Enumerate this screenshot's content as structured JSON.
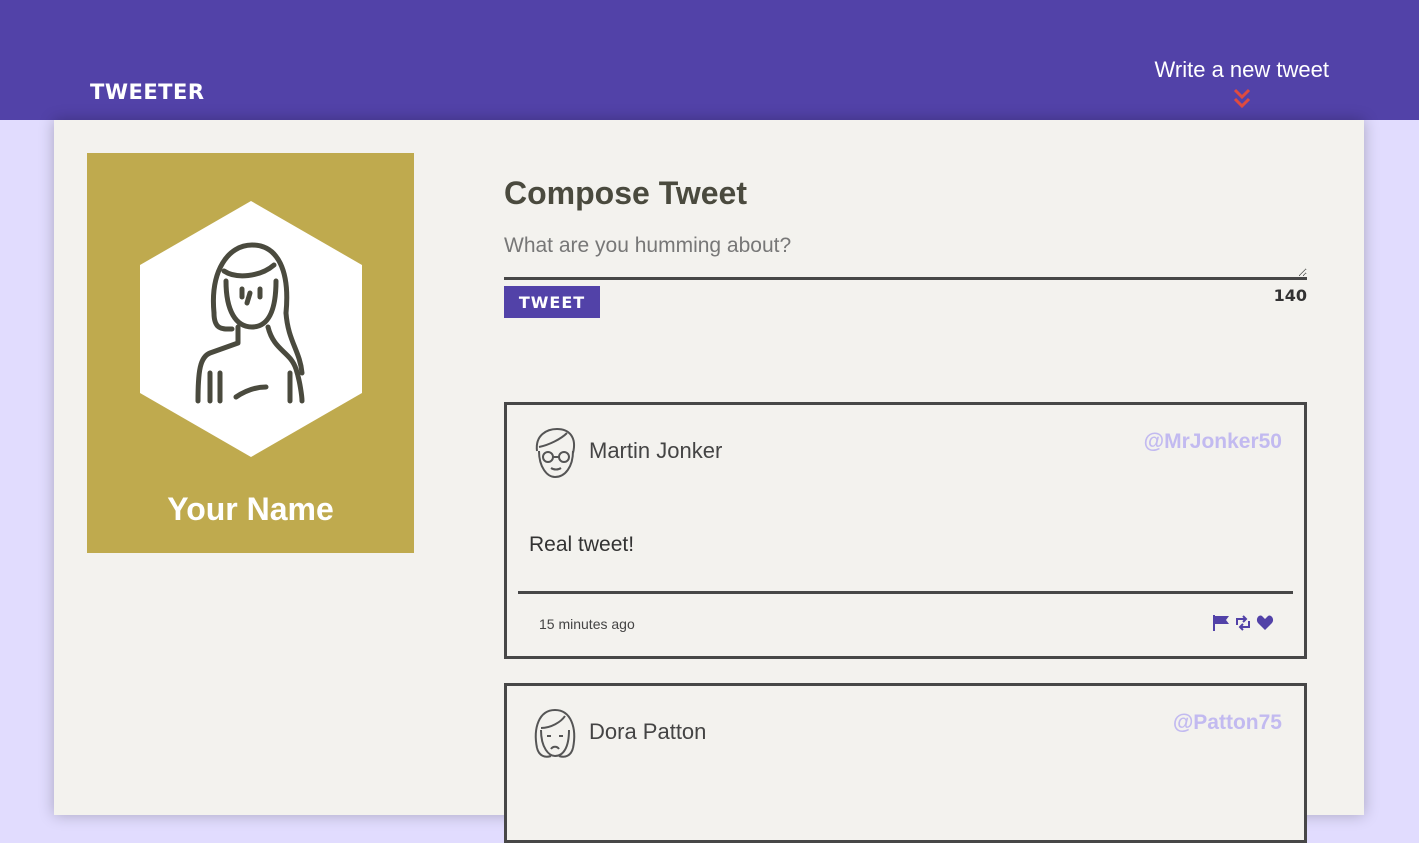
{
  "header": {
    "brand": "TWEETER",
    "new_tweet_label": "Write a new tweet"
  },
  "profile": {
    "name": "Your Name",
    "avatar_icon": "woman-avatar-icon"
  },
  "compose": {
    "title": "Compose Tweet",
    "placeholder": "What are you humming about?",
    "button_label": "TWEET",
    "counter": "140"
  },
  "tweets": [
    {
      "name": "Martin Jonker",
      "handle": "@MrJonker50",
      "content": "Real tweet!",
      "time": "15 minutes ago",
      "avatar_icon": "man-glasses-avatar-icon"
    },
    {
      "name": "Dora Patton",
      "handle": "@Patton75",
      "avatar_icon": "woman-avatar-icon"
    }
  ],
  "colors": {
    "header": "#5242a8",
    "accent": "#5242a8",
    "chevron": "#e04b3f",
    "profile_bg": "#bfaa4e",
    "handle": "#c2baf0",
    "page_bg": "#e1dcfe"
  }
}
